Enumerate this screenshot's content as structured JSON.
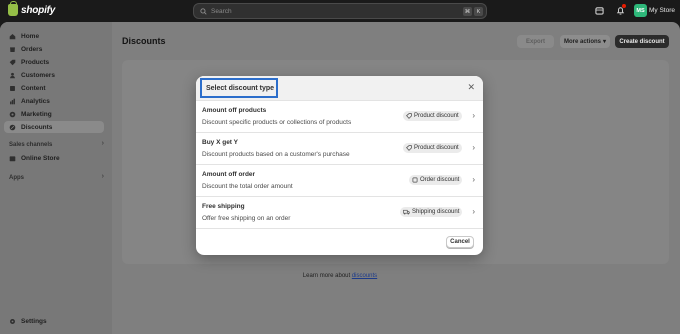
{
  "topbar": {
    "logo_text": "shopify",
    "search_placeholder": "Search",
    "kbd1": "⌘",
    "kbd2": "K",
    "store_initials": "MS",
    "store_name": "My Store"
  },
  "sidebar": {
    "items": [
      {
        "label": "Home",
        "icon": "home-icon"
      },
      {
        "label": "Orders",
        "icon": "orders-icon"
      },
      {
        "label": "Products",
        "icon": "products-icon"
      },
      {
        "label": "Customers",
        "icon": "customers-icon"
      },
      {
        "label": "Content",
        "icon": "content-icon"
      },
      {
        "label": "Analytics",
        "icon": "analytics-icon"
      },
      {
        "label": "Marketing",
        "icon": "marketing-icon"
      },
      {
        "label": "Discounts",
        "icon": "discounts-icon"
      }
    ],
    "sales_channels_label": "Sales channels",
    "online_store_label": "Online Store",
    "apps_label": "Apps",
    "settings_label": "Settings"
  },
  "page": {
    "title": "Discounts",
    "export_label": "Export",
    "more_actions_label": "More actions",
    "create_label": "Create discount",
    "learn_more_prefix": "Learn more about ",
    "learn_more_link": "discounts"
  },
  "modal": {
    "title": "Select discount type",
    "options": [
      {
        "title": "Amount off products",
        "description": "Discount specific products or collections of products",
        "badge": "Product discount"
      },
      {
        "title": "Buy X get Y",
        "description": "Discount products based on a customer's purchase",
        "badge": "Product discount"
      },
      {
        "title": "Amount off order",
        "description": "Discount the total order amount",
        "badge": "Order discount"
      },
      {
        "title": "Free shipping",
        "description": "Offer free shipping on an order",
        "badge": "Shipping discount"
      }
    ],
    "cancel_label": "Cancel"
  },
  "colors": {
    "accent_focus": "#2c6ecb",
    "brand_green": "#95bf47",
    "avatar_green": "#2eb87a"
  }
}
